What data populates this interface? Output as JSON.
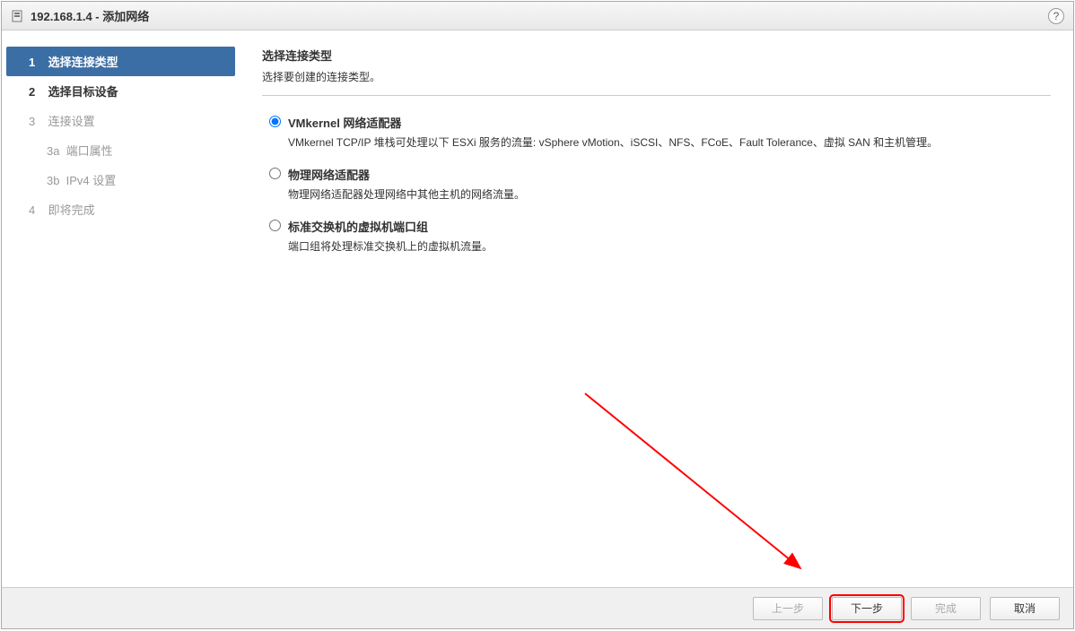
{
  "title": "192.168.1.4 - 添加网络",
  "sidebar": {
    "steps": [
      {
        "num": "1",
        "label": "选择连接类型",
        "state": "active"
      },
      {
        "num": "2",
        "label": "选择目标设备",
        "state": "bold"
      },
      {
        "num": "3",
        "label": "连接设置",
        "state": "disabled"
      },
      {
        "num": "3a",
        "label": "端口属性",
        "state": "sub"
      },
      {
        "num": "3b",
        "label": "IPv4 设置",
        "state": "sub"
      },
      {
        "num": "4",
        "label": "即将完成",
        "state": "disabled"
      }
    ]
  },
  "panel": {
    "title": "选择连接类型",
    "subtitle": "选择要创建的连接类型。"
  },
  "options": [
    {
      "label": "VMkernel 网络适配器",
      "desc": "VMkernel TCP/IP 堆栈可处理以下 ESXi 服务的流量: vSphere vMotion、iSCSI、NFS、FCoE、Fault Tolerance、虚拟 SAN 和主机管理。",
      "selected": true
    },
    {
      "label": "物理网络适配器",
      "desc": "物理网络适配器处理网络中其他主机的网络流量。",
      "selected": false
    },
    {
      "label": "标准交换机的虚拟机端口组",
      "desc": "端口组将处理标准交换机上的虚拟机流量。",
      "selected": false
    }
  ],
  "footer": {
    "back": "上一步",
    "next": "下一步",
    "finish": "完成",
    "cancel": "取消"
  }
}
